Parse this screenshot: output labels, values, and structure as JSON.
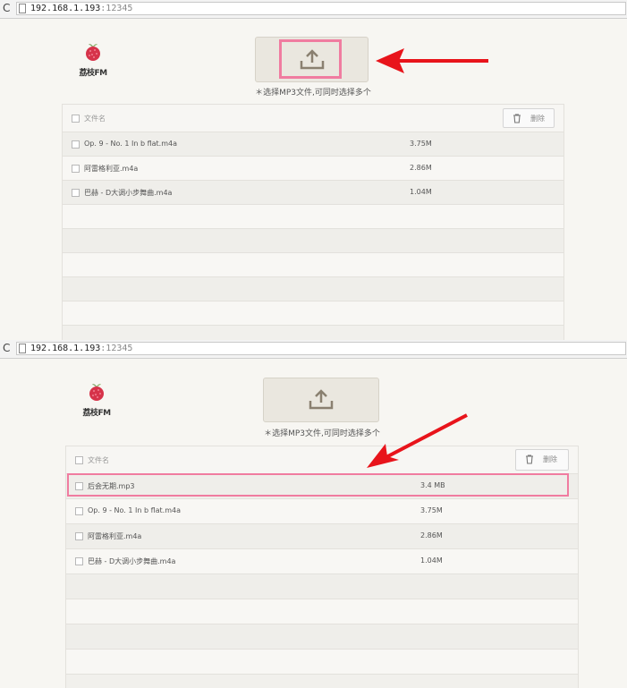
{
  "browser": {
    "url_host": "192.168.1.193",
    "url_port": ":12345"
  },
  "app": {
    "logo_text": "荔枝FM",
    "upload_hint": "＊选择MP3文件,可同时选择多个"
  },
  "table": {
    "header": "文件名",
    "delete_label": "删除"
  },
  "top_panel": {
    "files": [
      {
        "name": "Op. 9 - No. 1 In b flat.m4a",
        "size": "3.75M"
      },
      {
        "name": "阿雷格利亚.m4a",
        "size": "2.86M"
      },
      {
        "name": "巴赫 - D大调小步舞曲.m4a",
        "size": "1.04M"
      }
    ]
  },
  "bottom_panel": {
    "files": [
      {
        "name": "后会无期.mp3",
        "size": "3.4 MB"
      },
      {
        "name": "Op. 9 - No. 1 In b flat.m4a",
        "size": "3.75M"
      },
      {
        "name": "阿雷格利亚.m4a",
        "size": "2.86M"
      },
      {
        "name": "巴赫 - D大调小步舞曲.m4a",
        "size": "1.04M"
      }
    ]
  },
  "colors": {
    "highlight": "#f07ca0",
    "arrow": "#e8141b",
    "accent": "#8a8070"
  },
  "icons": [
    "reload-icon",
    "page-icon",
    "lychee-logo-icon",
    "upload-icon",
    "trash-icon",
    "checkbox-icon",
    "arrow-annotation-icon"
  ]
}
